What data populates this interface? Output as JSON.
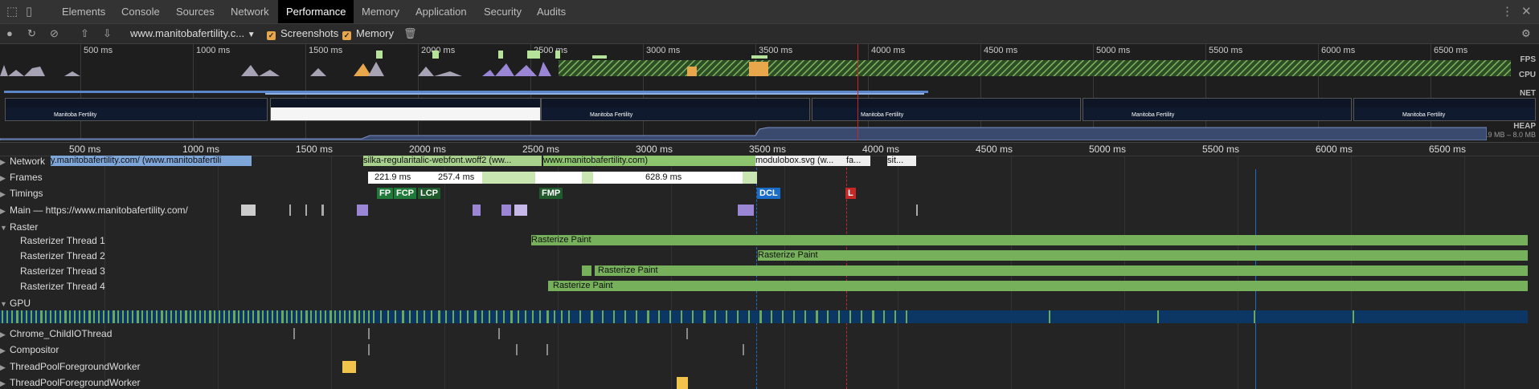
{
  "tabs": [
    {
      "label": "Elements",
      "active": false
    },
    {
      "label": "Console",
      "active": false
    },
    {
      "label": "Sources",
      "active": false
    },
    {
      "label": "Network",
      "active": false
    },
    {
      "label": "Performance",
      "active": true
    },
    {
      "label": "Memory",
      "active": false
    },
    {
      "label": "Application",
      "active": false
    },
    {
      "label": "Security",
      "active": false
    },
    {
      "label": "Audits",
      "active": false
    }
  ],
  "toolbar": {
    "profile_select": "www.manitobafertility.c...",
    "screenshots_label": "Screenshots",
    "memory_label": "Memory",
    "screenshots_checked": true,
    "memory_checked": true
  },
  "overview": {
    "ticks": [
      "500 ms",
      "1000 ms",
      "1500 ms",
      "2000 ms",
      "2500 ms",
      "3000 ms",
      "3500 ms",
      "4000 ms",
      "4500 ms",
      "5000 ms",
      "5500 ms",
      "6000 ms",
      "6500 ms"
    ],
    "lanes": {
      "fps": "FPS",
      "cpu": "CPU",
      "net": "NET",
      "heap": "HEAP"
    },
    "heap_range": "5.9 MB – 8.0 MB",
    "screenshot_caption": "Manitoba Fertility"
  },
  "ruler_ticks": [
    "500 ms",
    "1000 ms",
    "1500 ms",
    "2000 ms",
    "2500 ms",
    "3000 ms",
    "3500 ms",
    "4000 ms",
    "4500 ms",
    "5000 ms",
    "5500 ms",
    "6000 ms",
    "6500 ms"
  ],
  "tracks": {
    "network": "Network",
    "frames": "Frames",
    "timings": "Timings",
    "main": "Main — https://www.manitobafertility.com/",
    "raster": "Raster",
    "raster_threads": [
      "Rasterizer Thread 1",
      "Rasterizer Thread 2",
      "Rasterizer Thread 3",
      "Rasterizer Thread 4"
    ],
    "gpu": "GPU",
    "childio": "Chrome_ChildIOThread",
    "compositor": "Compositor",
    "pool1": "ThreadPoolForegroundWorker",
    "pool2": "ThreadPoolForegroundWorker"
  },
  "network_requests": [
    "y.manitobafertility.com/ (www.manitobafertili",
    "silka-regularitalic-webfont.woff2 (ww...",
    "www.manitobafertility.com)",
    "modulobox.svg (w...",
    "fa...",
    "sit..."
  ],
  "frames": [
    "221.9 ms",
    "257.4 ms",
    "628.9 ms"
  ],
  "timings": {
    "fp": "FP",
    "fcp": "FCP",
    "lcp": "LCP",
    "fmp": "FMP",
    "dcl": "DCL",
    "l": "L"
  },
  "raster_task": "Rasterize Paint",
  "colors": {
    "accent_green": "#76b05b",
    "dcl_blue": "#1a6cc9",
    "load_red": "#c62828",
    "fp_green": "#1f7a3a",
    "purple": "#9b86d6",
    "gpu_blue": "#0c3764"
  }
}
